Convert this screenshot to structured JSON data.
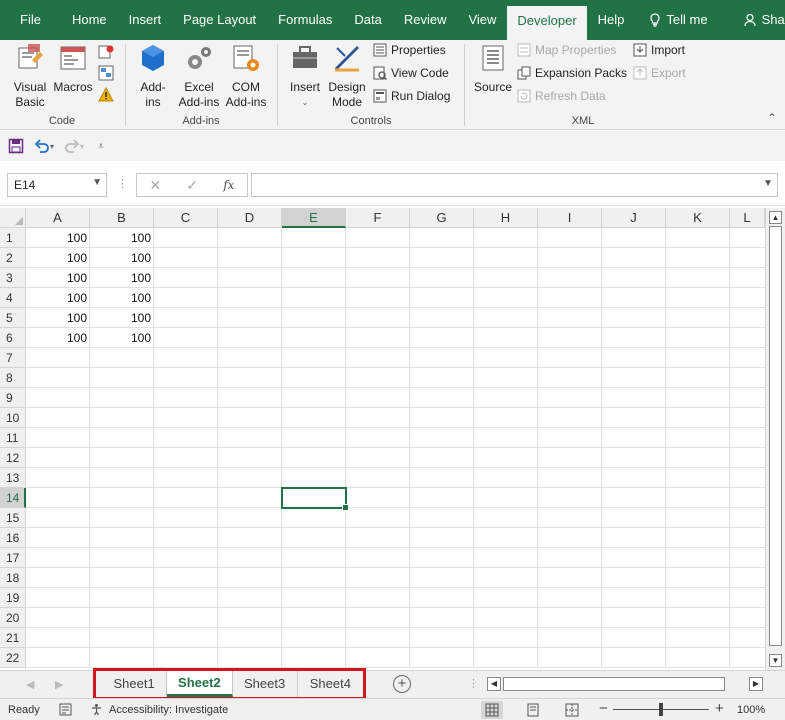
{
  "ribbon_tabs": [
    "File",
    "Home",
    "Insert",
    "Page Layout",
    "Formulas",
    "Data",
    "Review",
    "View",
    "Developer",
    "Help"
  ],
  "active_tab": "Developer",
  "tell_me": "Tell me",
  "share": "Share",
  "groups": {
    "code": {
      "label": "Code",
      "visual_basic": [
        "Visual",
        "Basic"
      ],
      "macros": "Macros"
    },
    "addins": {
      "label": "Add-ins",
      "addins": [
        "Add-",
        "ins"
      ],
      "excel_addins": [
        "Excel",
        "Add-ins"
      ],
      "com_addins": [
        "COM",
        "Add-ins"
      ]
    },
    "controls": {
      "label": "Controls",
      "insert": "Insert",
      "design_mode": [
        "Design",
        "Mode"
      ],
      "properties": "Properties",
      "view_code": "View Code",
      "run_dialog": "Run Dialog"
    },
    "xml": {
      "label": "XML",
      "source": "Source",
      "map_properties": "Map Properties",
      "expansion_packs": "Expansion Packs",
      "refresh_data": "Refresh Data",
      "import": "Import",
      "export": "Export"
    }
  },
  "name_box": "E14",
  "formula_value": "",
  "fx_label": "fx",
  "columns": [
    "A",
    "B",
    "C",
    "D",
    "E",
    "F",
    "G",
    "H",
    "I",
    "J",
    "K",
    "L"
  ],
  "selected_column": "E",
  "rows": [
    "1",
    "2",
    "3",
    "4",
    "5",
    "6",
    "7",
    "8",
    "9",
    "10",
    "11",
    "12",
    "13",
    "14",
    "15",
    "16",
    "17",
    "18",
    "19",
    "20",
    "21",
    "22"
  ],
  "selected_row": "14",
  "cell_data": [
    {
      "row": 1,
      "A": "100",
      "B": "100"
    },
    {
      "row": 2,
      "A": "100",
      "B": "100"
    },
    {
      "row": 3,
      "A": "100",
      "B": "100"
    },
    {
      "row": 4,
      "A": "100",
      "B": "100"
    },
    {
      "row": 5,
      "A": "100",
      "B": "100"
    },
    {
      "row": 6,
      "A": "100",
      "B": "100"
    }
  ],
  "sheets": [
    "Sheet1",
    "Sheet2",
    "Sheet3",
    "Sheet4"
  ],
  "active_sheet": "Sheet2",
  "status": {
    "ready": "Ready",
    "accessibility": "Accessibility: Investigate",
    "zoom": "100%"
  },
  "colors": {
    "brand": "#217346",
    "highlight_box": "#d2161e"
  }
}
